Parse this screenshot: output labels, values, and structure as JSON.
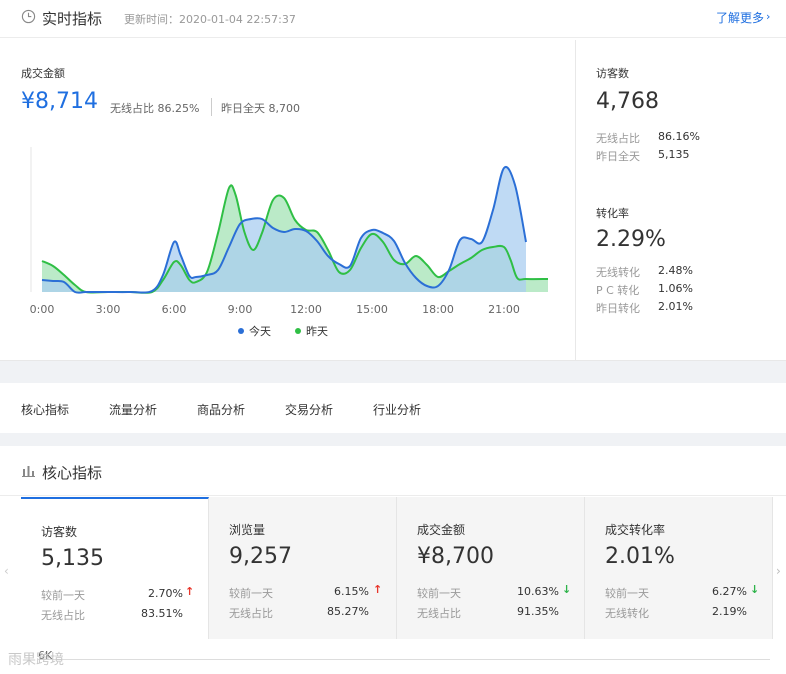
{
  "header": {
    "title": "实时指标",
    "update_time": "更新时间：2020-01-04 22:57:37",
    "learn_more": "了解更多",
    "learn_more_chevron": "›"
  },
  "gmv": {
    "label": "成交金额",
    "value": "¥8,714",
    "wireless_ratio": "无线占比  86.25%",
    "yesterday_total": "昨日全天  8,700"
  },
  "chart_data": {
    "type": "area",
    "x_ticks": [
      "0:00",
      "3:00",
      "6:00",
      "9:00",
      "12:00",
      "15:00",
      "18:00",
      "21:00"
    ],
    "legend_position": "bottom-center",
    "series": [
      {
        "name": "今天",
        "color": "#2b6fd6",
        "fill": "#a9cdf0",
        "points": [
          [
            0,
            280
          ],
          [
            0.5,
            281
          ],
          [
            1,
            282
          ],
          [
            1.5,
            292
          ],
          [
            2,
            292
          ],
          [
            3,
            292
          ],
          [
            4,
            292
          ],
          [
            5,
            291
          ],
          [
            5.5,
            275
          ],
          [
            6,
            242
          ],
          [
            6.3,
            255
          ],
          [
            6.7,
            276
          ],
          [
            7,
            277
          ],
          [
            7.5,
            275
          ],
          [
            8,
            270
          ],
          [
            8.5,
            247
          ],
          [
            9,
            224
          ],
          [
            9.5,
            219
          ],
          [
            10,
            219
          ],
          [
            10.5,
            228
          ],
          [
            11,
            232
          ],
          [
            11.5,
            229
          ],
          [
            12,
            231
          ],
          [
            12.5,
            241
          ],
          [
            13,
            256
          ],
          [
            13.5,
            264
          ],
          [
            14,
            266
          ],
          [
            14.5,
            238
          ],
          [
            15,
            230
          ],
          [
            15.5,
            233
          ],
          [
            16,
            241
          ],
          [
            16.5,
            263
          ],
          [
            17,
            278
          ],
          [
            17.5,
            286
          ],
          [
            18,
            286
          ],
          [
            18.5,
            270
          ],
          [
            19,
            240
          ],
          [
            19.5,
            239
          ],
          [
            20,
            242
          ],
          [
            20.5,
            210
          ],
          [
            21,
            168
          ],
          [
            21.5,
            185
          ],
          [
            22,
            242
          ]
        ]
      },
      {
        "name": "昨天",
        "color": "#2fbf45",
        "fill": "#a4e3b6",
        "points": [
          [
            0,
            261
          ],
          [
            0.5,
            266
          ],
          [
            1,
            275
          ],
          [
            1.5,
            285
          ],
          [
            2,
            292
          ],
          [
            3,
            292
          ],
          [
            4,
            292
          ],
          [
            5,
            292
          ],
          [
            5.5,
            280
          ],
          [
            6,
            262
          ],
          [
            6.3,
            265
          ],
          [
            6.7,
            280
          ],
          [
            7,
            282
          ],
          [
            7.5,
            272
          ],
          [
            8,
            233
          ],
          [
            8.5,
            188
          ],
          [
            8.8,
            195
          ],
          [
            9.2,
            232
          ],
          [
            9.6,
            250
          ],
          [
            10,
            233
          ],
          [
            10.5,
            200
          ],
          [
            11,
            198
          ],
          [
            11.5,
            220
          ],
          [
            12,
            230
          ],
          [
            12.5,
            232
          ],
          [
            13,
            250
          ],
          [
            13.5,
            272
          ],
          [
            14,
            270
          ],
          [
            14.5,
            248
          ],
          [
            15,
            234
          ],
          [
            15.5,
            242
          ],
          [
            16,
            260
          ],
          [
            16.5,
            264
          ],
          [
            17,
            256
          ],
          [
            17.5,
            265
          ],
          [
            18,
            277
          ],
          [
            18.5,
            271
          ],
          [
            19,
            264
          ],
          [
            19.5,
            258
          ],
          [
            20,
            250
          ],
          [
            20.5,
            247
          ],
          [
            21,
            247
          ],
          [
            21.3,
            260
          ],
          [
            21.6,
            278
          ],
          [
            22,
            279
          ],
          [
            23,
            279
          ]
        ]
      }
    ]
  },
  "visitors": {
    "label": "访客数",
    "value": "4,768",
    "rows": [
      {
        "label": "无线占比",
        "value": "86.16%"
      },
      {
        "label": "昨日全天",
        "value": "5,135"
      }
    ]
  },
  "conversion": {
    "label": "转化率",
    "value": "2.29%",
    "rows": [
      {
        "label": "无线转化",
        "value": "2.48%"
      },
      {
        "label": "P C 转化",
        "value": "1.06%"
      },
      {
        "label": "昨日转化",
        "value": "2.01%"
      }
    ]
  },
  "tabs": [
    "核心指标",
    "流量分析",
    "商品分析",
    "交易分析",
    "行业分析"
  ],
  "core": {
    "title": "核心指标",
    "nav_left": "‹",
    "nav_right": "›",
    "bottom_label": "6K",
    "watermark": "雨果跨境",
    "cards": [
      {
        "label": "访客数",
        "value": "5,135",
        "row1_label": "较前一天",
        "row1_value": "2.70%",
        "row1_arrow": "↑",
        "row1_dir": "up",
        "row2_label": "无线占比",
        "row2_value": "83.51%"
      },
      {
        "label": "浏览量",
        "value": "9,257",
        "row1_label": "较前一天",
        "row1_value": "6.15%",
        "row1_arrow": "↑",
        "row1_dir": "up",
        "row2_label": "无线占比",
        "row2_value": "85.27%"
      },
      {
        "label": "成交金额",
        "value": "¥8,700",
        "row1_label": "较前一天",
        "row1_value": "10.63%",
        "row1_arrow": "↓",
        "row1_dir": "down",
        "row2_label": "无线占比",
        "row2_value": "91.35%"
      },
      {
        "label": "成交转化率",
        "value": "2.01%",
        "row1_label": "较前一天",
        "row1_value": "6.27%",
        "row1_arrow": "↓",
        "row1_dir": "down",
        "row2_label": "无线转化",
        "row2_value": "2.19%"
      }
    ]
  }
}
